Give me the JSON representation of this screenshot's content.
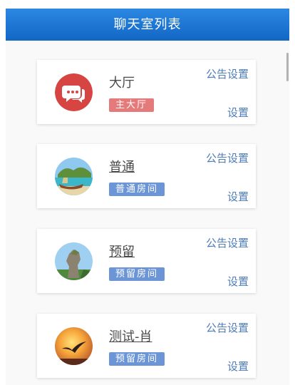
{
  "header": {
    "title": "聊天室列表"
  },
  "rooms": [
    {
      "name": "大厅",
      "badge": "主大厅",
      "notice_label": "公告设置",
      "settings_label": "设置",
      "badge_color": "#e57a7a",
      "avatar_icon": "speech-bubbles"
    },
    {
      "name": "普通",
      "badge": "普通房间",
      "notice_label": "公告设置",
      "settings_label": "设置",
      "badge_color": "#6b95d6",
      "avatar_icon": "beach-boat"
    },
    {
      "name": "预留",
      "badge": "预留房间",
      "notice_label": "公告设置",
      "settings_label": "设置",
      "badge_color": "#6b95d6",
      "avatar_icon": "rock-tower"
    },
    {
      "name": "测试-肖",
      "badge": "预留房间",
      "notice_label": "公告设置",
      "settings_label": "设置",
      "badge_color": "#6b95d6",
      "avatar_icon": "sunset-bird"
    }
  ],
  "colors": {
    "header": "#1a74d6",
    "link": "#4d7cb8"
  }
}
